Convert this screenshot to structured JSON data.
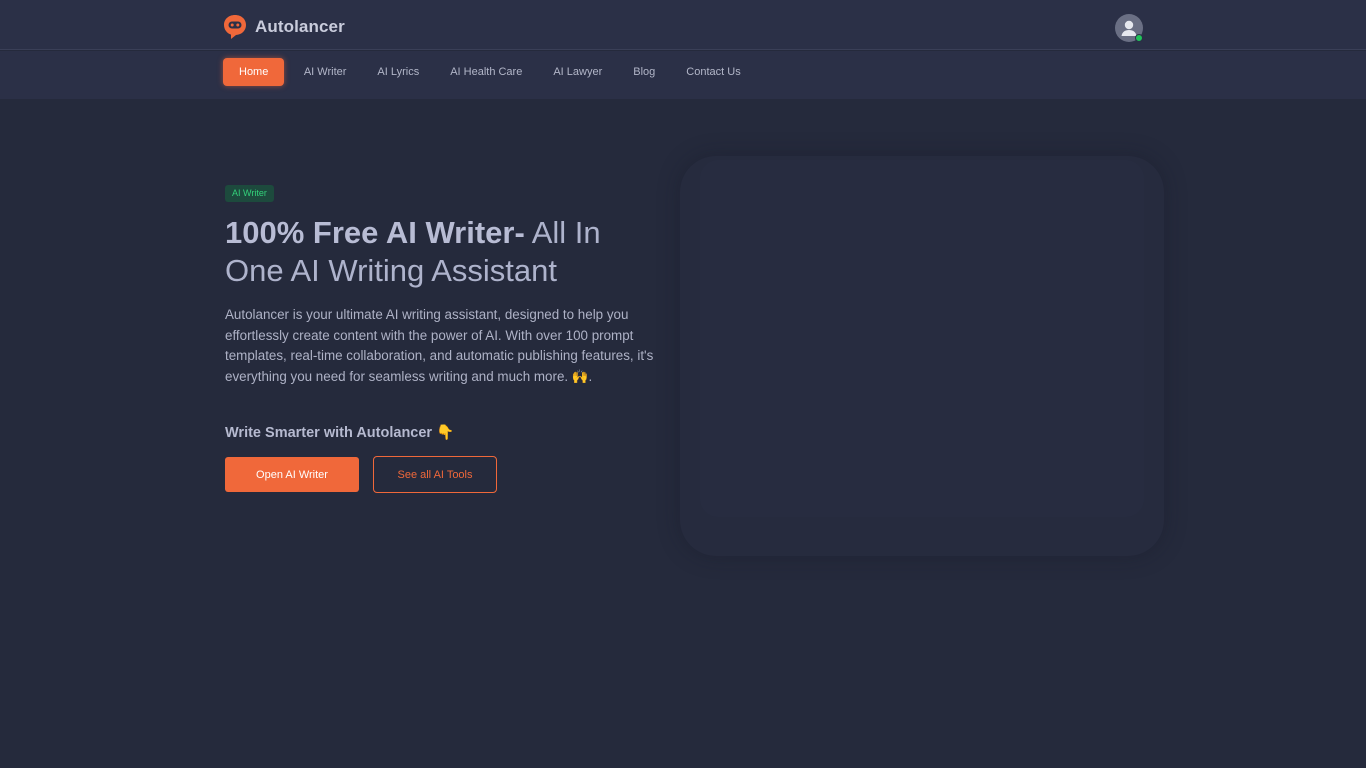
{
  "brand": {
    "name": "Autolancer"
  },
  "nav": {
    "items": [
      {
        "label": "Home",
        "active": true
      },
      {
        "label": "AI Writer"
      },
      {
        "label": "AI Lyrics"
      },
      {
        "label": "AI Health Care"
      },
      {
        "label": "AI Lawyer"
      },
      {
        "label": "Blog"
      },
      {
        "label": "Contact Us"
      }
    ]
  },
  "hero": {
    "badge": "AI Writer",
    "title_strong": "100% Free AI Writer-",
    "title_rest": " All In One AI Writing Assistant",
    "description": "Autolancer is your ultimate AI writing assistant, designed to help you effortlessly create content with the power of AI. With over 100 prompt templates, real-time collaboration, and automatic publishing features, it's everything you need for seamless writing and much more. 🙌.",
    "subheading": "Write Smarter with Autolancer 👇",
    "primary_button": "Open AI Writer",
    "secondary_button": "See all AI Tools"
  },
  "icons": {
    "logo": "robot-chat-logo-icon",
    "avatar": "user-avatar-icon"
  },
  "colors": {
    "accent": "#f0683a",
    "background": "#252a3c",
    "header": "#2b3047",
    "badge_bg": "#1d4a3d",
    "badge_text": "#33d07a",
    "online": "#20c45a"
  }
}
